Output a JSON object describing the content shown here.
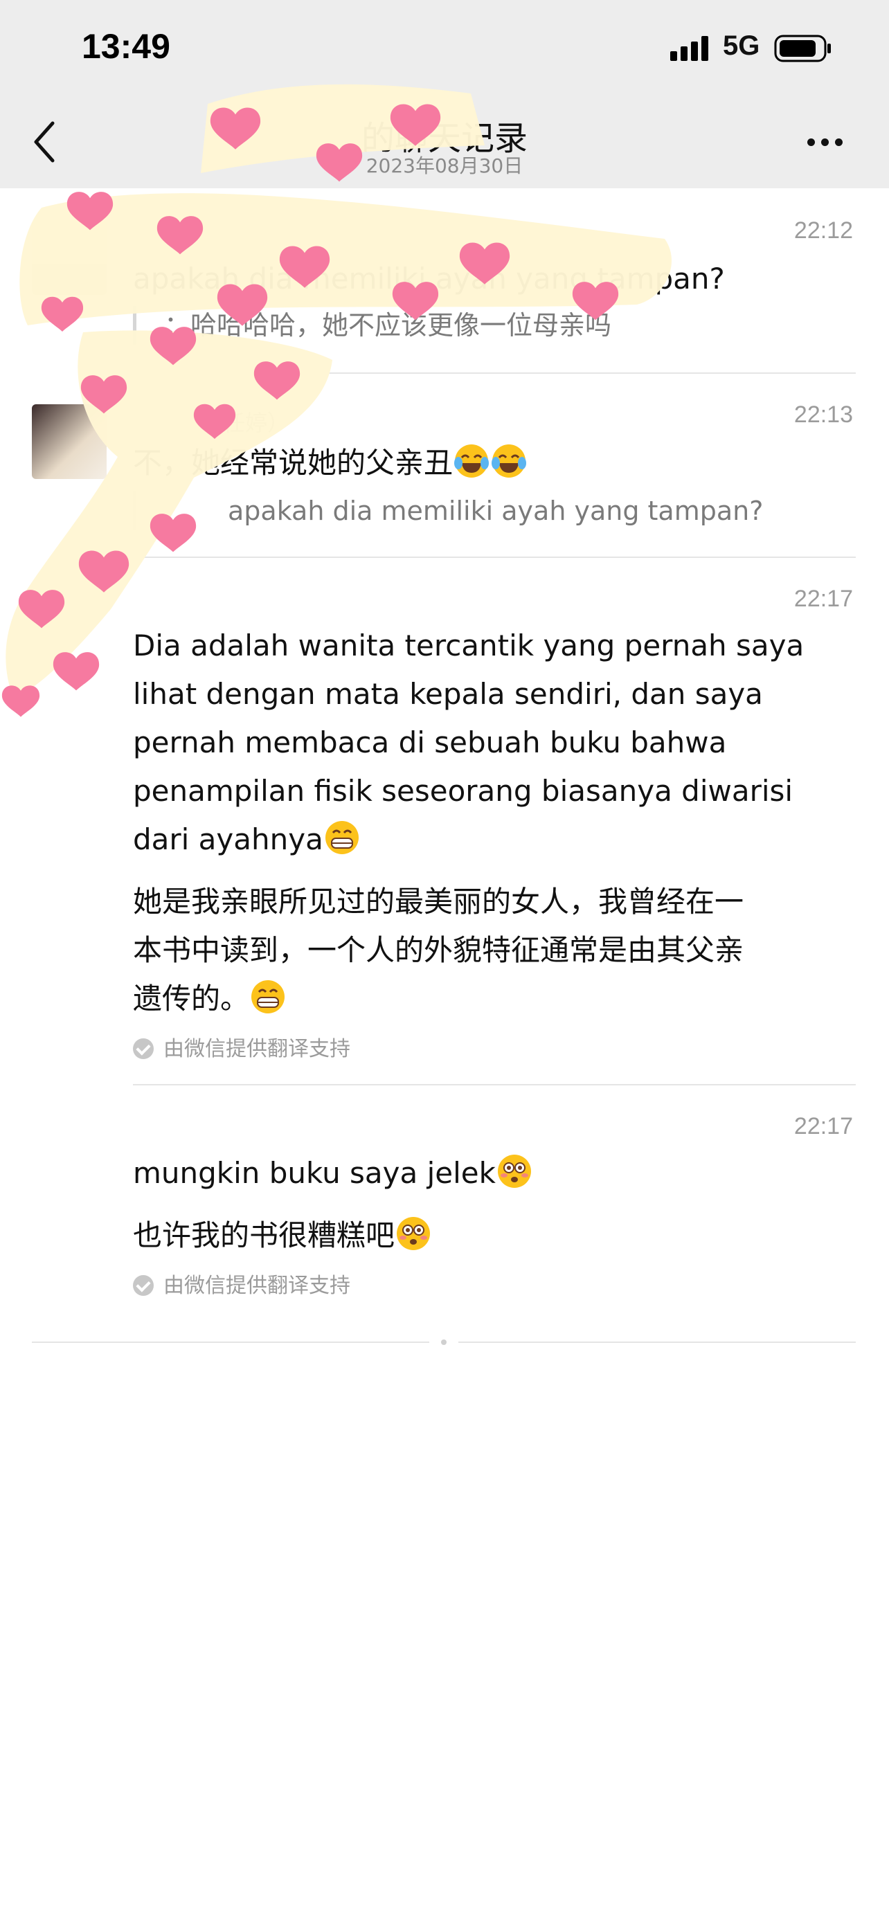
{
  "status_bar": {
    "time": "13:49",
    "network": "5G"
  },
  "nav": {
    "title": "的聊天记录",
    "subtitle": "2023年08月30日"
  },
  "messages": [
    {
      "time": "22:12",
      "text": "apakah dia memiliki ayah yang tampan?",
      "quote": "：哈哈哈哈，她不应该更像一位母亲吗"
    },
    {
      "time": "22:13",
      "sender": "（任婷）",
      "text": "不，她经常说她的父亲丑",
      "quote": "apakah dia memiliki ayah yang tampan?"
    },
    {
      "time": "22:17",
      "lines": [
        "Dia adalah wanita tercantik yang pernah saya",
        "lihat dengan mata kepala sendiri, dan saya",
        "pernah membaca di sebuah buku bahwa",
        "penampilan fisik seseorang biasanya diwarisi",
        "dari ayahnya"
      ],
      "translation_lines": [
        "她是我亲眼所见过的最美丽的女人，我曾经在一",
        "本书中读到，一个人的外貌特征通常是由其父亲",
        "遗传的。"
      ],
      "note": "由微信提供翻译支持"
    },
    {
      "time": "22:17",
      "text": "mungkin buku saya jelek",
      "translation": "也许我的书很糟糕吧",
      "note": "由微信提供翻译支持"
    }
  ],
  "colors": {
    "header_bg": "#ededed",
    "sticker_pink": "#f67aa0",
    "sticker_cream": "#fff6d4"
  }
}
